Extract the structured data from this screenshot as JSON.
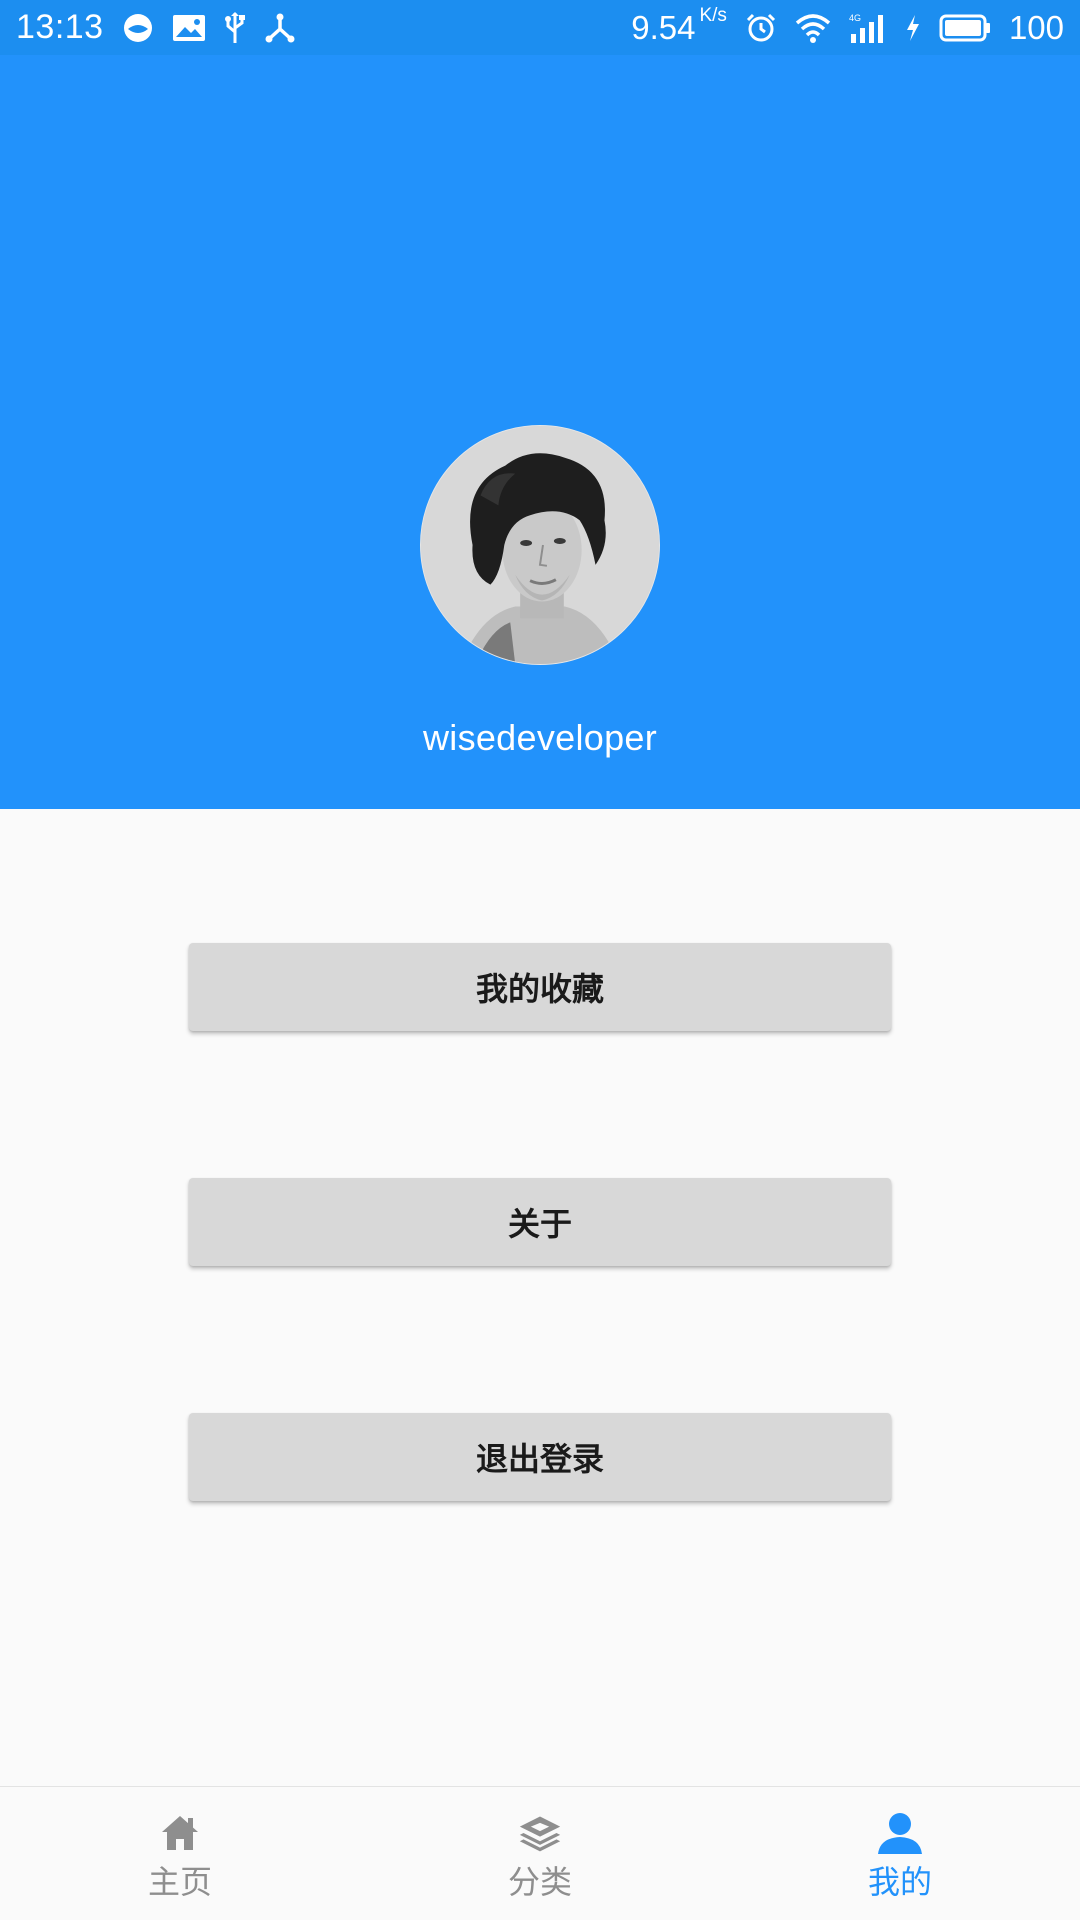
{
  "status_bar": {
    "time": "13:13",
    "net_speed": "9.54",
    "net_speed_unit": "K/s",
    "battery_level": "100",
    "left_icons": [
      "browser-icon",
      "image-notification-icon",
      "usb-icon",
      "hotspot-icon"
    ],
    "right_icons": [
      "alarm-icon",
      "wifi-icon",
      "4g-signal-icon",
      "charging-icon",
      "battery-icon"
    ]
  },
  "colors": {
    "status_bar_bg": "#1c8ef0",
    "header_bg": "#2292fb",
    "accent": "#2292fb",
    "button_bg": "#d8d8d8",
    "page_bg": "#fafafa",
    "inactive_nav": "#8e8e8e"
  },
  "profile": {
    "username": "wisedeveloper",
    "avatar": "user-avatar-photo"
  },
  "actions": {
    "favorites_label": "我的收藏",
    "about_label": "关于",
    "logout_label": "退出登录"
  },
  "bottom_nav": {
    "items": [
      {
        "label": "主页",
        "icon": "home-icon",
        "active": false
      },
      {
        "label": "分类",
        "icon": "layers-icon",
        "active": false
      },
      {
        "label": "我的",
        "icon": "person-icon",
        "active": true
      }
    ]
  }
}
